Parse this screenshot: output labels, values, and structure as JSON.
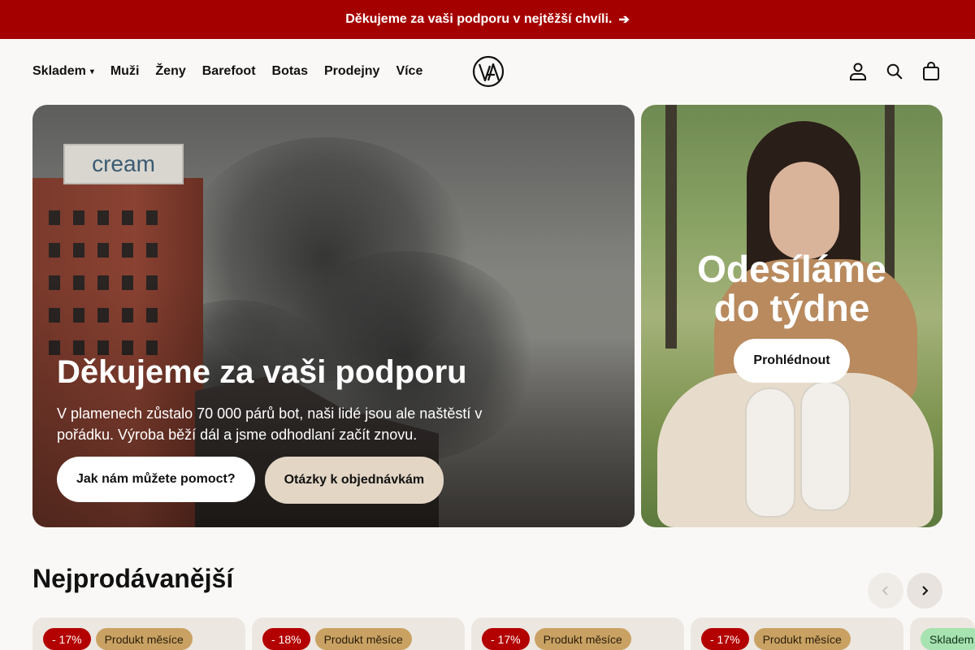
{
  "announcement": {
    "text": "Děkujeme za vaši podporu v nejtěžší chvíli.",
    "arrow": "➔"
  },
  "nav": {
    "items": [
      {
        "label": "Skladem",
        "has_caret": true
      },
      {
        "label": "Muži"
      },
      {
        "label": "Ženy"
      },
      {
        "label": "Barefoot"
      },
      {
        "label": "Botas"
      },
      {
        "label": "Prodejny"
      },
      {
        "label": "Více"
      }
    ],
    "caret": "▾"
  },
  "logo": {
    "text": "VA"
  },
  "header_icons": [
    "account-icon",
    "search-icon",
    "cart-icon"
  ],
  "hero": {
    "sign_text": "cream",
    "title": "Děkujeme za vaši podporu",
    "text": "V plamenech zůstalo 70 000 párů bot, naši lidé jsou ale naštěstí v pořádku. Výroba běží dál a jsme odhodlaní začít znovu.",
    "button_primary": "Jak nám můžete pomoct?",
    "button_secondary": "Otázky k objednávkám"
  },
  "promo": {
    "title_line1": "Odesíláme",
    "title_line2": "do týdne",
    "button": "Prohlédnout"
  },
  "bestsellers": {
    "title": "Nejprodávanější",
    "prev_icon": "‹",
    "next_icon": "›",
    "cards": [
      {
        "discount": "- 17%",
        "tag": "Produkt měsíce"
      },
      {
        "discount": "- 18%",
        "tag": "Produkt měsíce"
      },
      {
        "discount": "- 17%",
        "tag": "Produkt měsíce"
      },
      {
        "discount": "- 17%",
        "tag": "Produkt měsíce"
      },
      {
        "stock": "Skladem"
      }
    ]
  },
  "colors": {
    "announcement_bg": "#a50000",
    "sale_badge": "#b30000",
    "month_badge": "#c9a263",
    "stock_badge": "#a7e3b0",
    "page_bg": "#faf8f6"
  }
}
